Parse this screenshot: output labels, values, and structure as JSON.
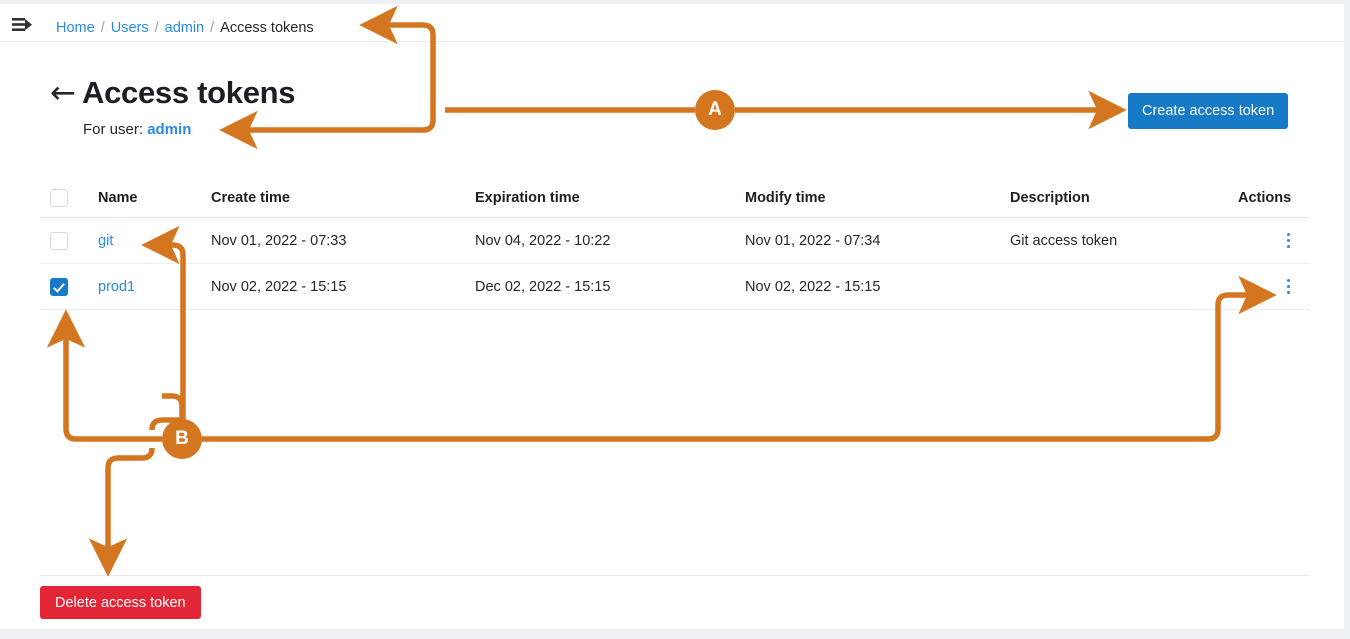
{
  "window": {
    "accent_blue": "#167ac6",
    "link_blue": "#2b8ae0",
    "danger_red": "#e32636",
    "annotation_orange": "#d4761f",
    "background": "#ffffff"
  },
  "topbar": {
    "menu_icon": "sidebar-expand-icon",
    "breadcrumb": [
      {
        "label": "Home",
        "link": true
      },
      {
        "label": "Users",
        "link": true
      },
      {
        "label": "admin",
        "link": true
      },
      {
        "label": "Access tokens",
        "link": false
      }
    ],
    "separator": "/"
  },
  "header": {
    "back_icon": "←",
    "title": "Access tokens",
    "subtitle_prefix": "For user:",
    "subtitle_user": "admin",
    "create_button": "Create access token"
  },
  "table": {
    "columns": [
      {
        "key": "select",
        "label": ""
      },
      {
        "key": "name",
        "label": "Name"
      },
      {
        "key": "create_time",
        "label": "Create time"
      },
      {
        "key": "expiration_time",
        "label": "Expiration time"
      },
      {
        "key": "modify_time",
        "label": "Modify time"
      },
      {
        "key": "description",
        "label": "Description"
      },
      {
        "key": "actions",
        "label": "Actions"
      }
    ],
    "select_all_checked": false,
    "rows": [
      {
        "selected": false,
        "name": "git",
        "create_time": "Nov 01, 2022 - 07:33",
        "expiration_time": "Nov 04, 2022 - 10:22",
        "modify_time": "Nov 01, 2022 - 07:34",
        "description": "Git access token",
        "actions_icon": "kebab-menu-icon"
      },
      {
        "selected": true,
        "name": "prod1",
        "create_time": "Nov 02, 2022 - 15:15",
        "expiration_time": "Dec 02, 2022 - 15:15",
        "modify_time": "Nov 02, 2022 - 15:15",
        "description": "",
        "actions_icon": "kebab-menu-icon"
      }
    ]
  },
  "footer": {
    "delete_button": "Delete access token"
  },
  "annotations": [
    {
      "id": "A",
      "label": "A",
      "targets": [
        "breadcrumb-current",
        "for-user-admin",
        "create-access-token-button"
      ]
    },
    {
      "id": "B",
      "label": "B",
      "targets": [
        "row-name-git",
        "row-checkbox-prod1",
        "row-actions-prod1",
        "delete-access-token-button"
      ]
    }
  ]
}
